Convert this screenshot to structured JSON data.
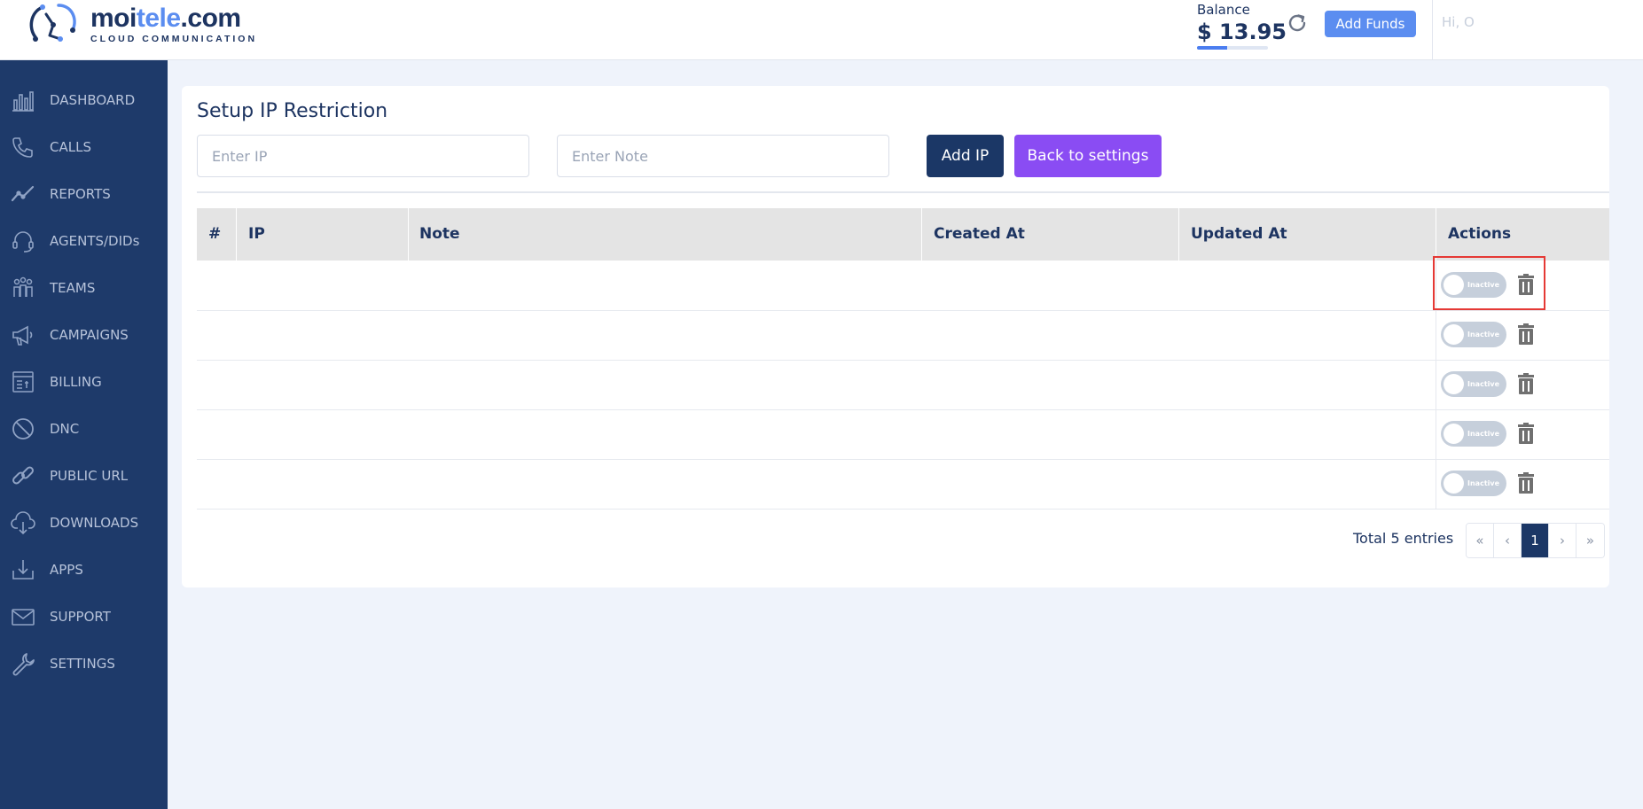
{
  "brand": {
    "name_part1": "moi",
    "name_part2": "tele",
    "name_part3": ".com",
    "tagline": "CLOUD COMMUNICATION"
  },
  "header": {
    "balance_label": "Balance",
    "balance_value": "$ 13.95",
    "balance_fraction": 0.42,
    "add_funds_label": "Add Funds",
    "greeting": "Hi, O"
  },
  "sidebar": {
    "items": [
      {
        "label": "DASHBOARD",
        "icon": "dashboard-chart-icon"
      },
      {
        "label": "CALLS",
        "icon": "phone-icon"
      },
      {
        "label": "REPORTS",
        "icon": "reports-trend-icon"
      },
      {
        "label": "AGENTS/DIDs",
        "icon": "headset-icon"
      },
      {
        "label": "TEAMS",
        "icon": "team-icon"
      },
      {
        "label": "CAMPAIGNS",
        "icon": "megaphone-icon"
      },
      {
        "label": "BILLING",
        "icon": "billing-icon"
      },
      {
        "label": "DNC",
        "icon": "block-icon"
      },
      {
        "label": "PUBLIC URL",
        "icon": "link-icon"
      },
      {
        "label": "DOWNLOADS",
        "icon": "cloud-download-icon"
      },
      {
        "label": "APPS",
        "icon": "apps-download-icon"
      },
      {
        "label": "SUPPORT",
        "icon": "mail-icon"
      },
      {
        "label": "SETTINGS",
        "icon": "wrench-icon"
      }
    ]
  },
  "page": {
    "title": "Setup IP Restriction",
    "ip_placeholder": "Enter IP",
    "note_placeholder": "Enter Note",
    "add_ip_label": "Add IP",
    "back_label": "Back to settings"
  },
  "table": {
    "columns": [
      "#",
      "IP",
      "Note",
      "Created At",
      "Updated At",
      "Actions"
    ],
    "rows": [
      {
        "toggle_label": "Inactive"
      },
      {
        "toggle_label": "Inactive"
      },
      {
        "toggle_label": "Inactive"
      },
      {
        "toggle_label": "Inactive"
      },
      {
        "toggle_label": "Inactive"
      }
    ]
  },
  "footer": {
    "total": "Total 5 entries",
    "pager": {
      "first": "«",
      "prev": "‹",
      "current": "1",
      "next": "›",
      "last": "»"
    }
  },
  "colors": {
    "sidebar_bg": "#1e3a6a",
    "primary": "#1b3766",
    "accent_purple": "#8a4cf3",
    "accent_blue": "#5b8df0",
    "highlight_red": "#e53935"
  }
}
